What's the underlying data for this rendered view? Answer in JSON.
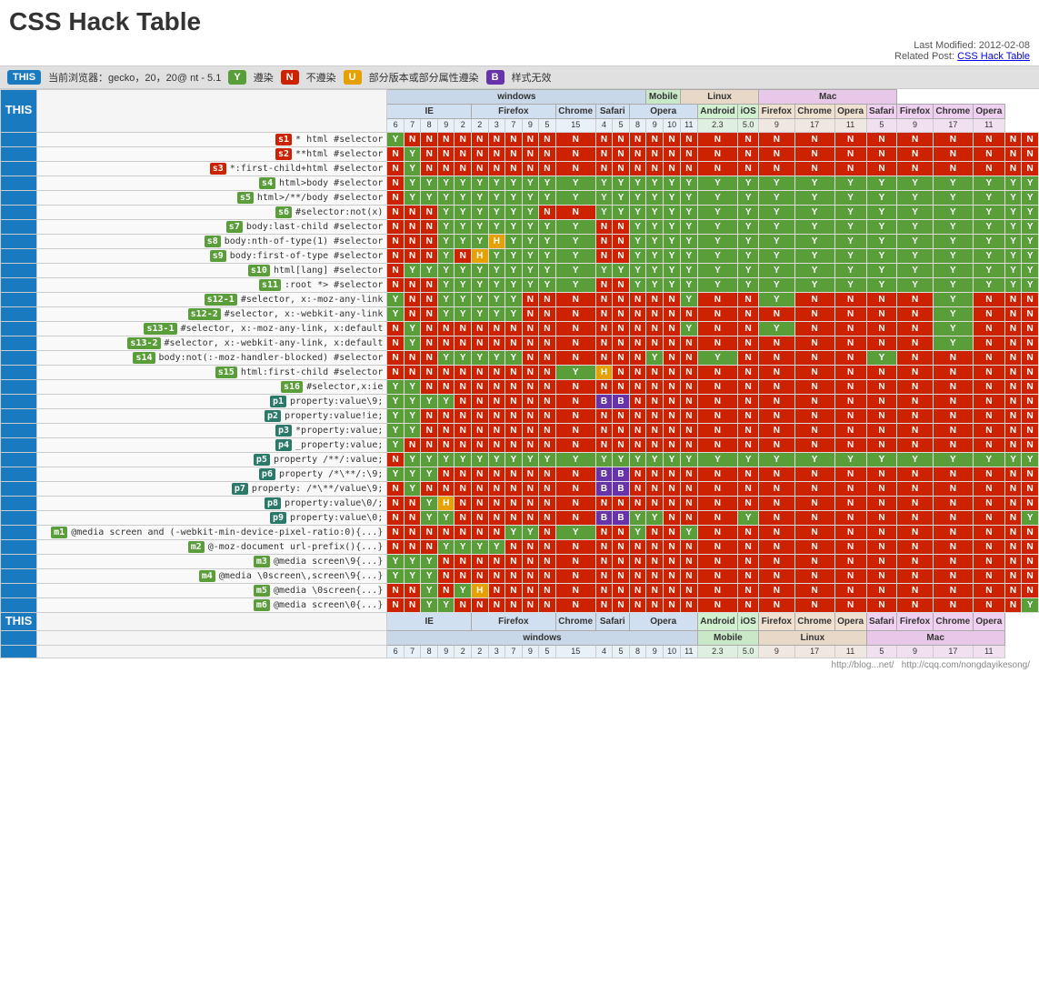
{
  "title": "CSS Hack Table",
  "meta": {
    "last_modified": "Last Modified: 2012-02-08",
    "related_label": "Related Post:",
    "related_link": "CSS Hack Table"
  },
  "legend": {
    "browser_label": "当前浏览器：gecko，20，20@ nt - 5.1",
    "y_label": "遵染",
    "n_label": "不遵染",
    "u_label": "部分版本或部分属性遵染",
    "b_label": "样式无效"
  },
  "this_label": "THIS",
  "browsers": {
    "windows": {
      "label": "windows",
      "ie": {
        "label": "IE",
        "versions": [
          "6",
          "7",
          "8",
          "9",
          "2"
        ]
      },
      "firefox": {
        "label": "Firefox",
        "versions": [
          "2",
          "3",
          "7",
          "9",
          "5"
        ]
      },
      "chrome": {
        "label": "Chrome",
        "versions": [
          "15"
        ]
      },
      "safari": {
        "label": "Safari",
        "versions": [
          "4",
          "5"
        ]
      },
      "opera": {
        "label": "Opera",
        "versions": [
          "8",
          "9",
          "10",
          "11"
        ]
      }
    },
    "mobile": {
      "label": "Mobile",
      "android": {
        "label": "Android",
        "versions": [
          "2.3"
        ]
      },
      "ios": {
        "label": "iOS",
        "versions": [
          "5.0"
        ]
      }
    },
    "linux": {
      "label": "Linux",
      "firefox": {
        "label": "Firefox",
        "versions": [
          "9"
        ]
      },
      "chrome": {
        "label": "Chrome",
        "versions": [
          "17"
        ]
      },
      "opera": {
        "label": "Opera",
        "versions": [
          "11"
        ]
      }
    },
    "mac": {
      "label": "Mac",
      "safari": {
        "label": "Safari",
        "versions": [
          "5"
        ]
      },
      "firefox": {
        "label": "Firefox",
        "versions": [
          "9"
        ]
      },
      "chrome": {
        "label": "Chrome",
        "versions": [
          "17"
        ]
      },
      "opera": {
        "label": "Opera",
        "versions": [
          "11"
        ]
      }
    }
  },
  "rows": [
    {
      "id": "s1",
      "id_class": "id-red",
      "label": "* html #selector",
      "cells": [
        "Y",
        "N",
        "N",
        "N",
        "N",
        "N",
        "N",
        "N",
        "N",
        "N",
        "N",
        "N",
        "N",
        "N",
        "N",
        "N",
        "N",
        "N",
        "N",
        "N",
        "N",
        "N",
        "N",
        "N",
        "N",
        "N",
        "N",
        "N"
      ]
    },
    {
      "id": "s2",
      "id_class": "id-red",
      "label": "**html #selector",
      "cells": [
        "N",
        "Y",
        "N",
        "N",
        "N",
        "N",
        "N",
        "N",
        "N",
        "N",
        "N",
        "N",
        "N",
        "N",
        "N",
        "N",
        "N",
        "N",
        "N",
        "N",
        "N",
        "N",
        "N",
        "N",
        "N",
        "N",
        "N",
        "N"
      ]
    },
    {
      "id": "s3",
      "id_class": "id-red",
      "label": "*:first-child+html #selector",
      "cells": [
        "N",
        "Y",
        "N",
        "N",
        "N",
        "N",
        "N",
        "N",
        "N",
        "N",
        "N",
        "N",
        "N",
        "N",
        "N",
        "N",
        "N",
        "N",
        "N",
        "N",
        "N",
        "N",
        "N",
        "N",
        "N",
        "N",
        "N",
        "N"
      ]
    },
    {
      "id": "s4",
      "id_class": "id-green",
      "label": "html>body #selector",
      "cells": [
        "N",
        "Y",
        "Y",
        "Y",
        "Y",
        "Y",
        "Y",
        "Y",
        "Y",
        "Y",
        "Y",
        "Y",
        "Y",
        "Y",
        "Y",
        "Y",
        "Y",
        "Y",
        "Y",
        "Y",
        "Y",
        "Y",
        "Y",
        "Y",
        "Y",
        "Y",
        "Y",
        "Y"
      ]
    },
    {
      "id": "s5",
      "id_class": "id-green",
      "label": "html>/**/body #selector",
      "cells": [
        "N",
        "Y",
        "Y",
        "Y",
        "Y",
        "Y",
        "Y",
        "Y",
        "Y",
        "Y",
        "Y",
        "Y",
        "Y",
        "Y",
        "Y",
        "Y",
        "Y",
        "Y",
        "Y",
        "Y",
        "Y",
        "Y",
        "Y",
        "Y",
        "Y",
        "Y",
        "Y",
        "Y"
      ]
    },
    {
      "id": "s6",
      "id_class": "id-green",
      "label": "#selector:not(x)",
      "cells": [
        "N",
        "N",
        "N",
        "Y",
        "Y",
        "Y",
        "Y",
        "Y",
        "Y",
        "N",
        "N",
        "Y",
        "Y",
        "Y",
        "Y",
        "Y",
        "Y",
        "Y",
        "Y",
        "Y",
        "Y",
        "Y",
        "Y",
        "Y",
        "Y",
        "Y",
        "Y",
        "Y"
      ]
    },
    {
      "id": "s7",
      "id_class": "id-green",
      "label": "body:last-child #selector",
      "cells": [
        "N",
        "N",
        "N",
        "Y",
        "Y",
        "Y",
        "Y",
        "Y",
        "Y",
        "Y",
        "Y",
        "N",
        "N",
        "Y",
        "Y",
        "Y",
        "Y",
        "Y",
        "Y",
        "Y",
        "Y",
        "Y",
        "Y",
        "Y",
        "Y",
        "Y",
        "Y",
        "Y"
      ]
    },
    {
      "id": "s8",
      "id_class": "id-green",
      "label": "body:nth-of-type(1) #selector",
      "cells": [
        "N",
        "N",
        "N",
        "Y",
        "Y",
        "Y",
        "H",
        "Y",
        "Y",
        "Y",
        "Y",
        "N",
        "N",
        "Y",
        "Y",
        "Y",
        "Y",
        "Y",
        "Y",
        "Y",
        "Y",
        "Y",
        "Y",
        "Y",
        "Y",
        "Y",
        "Y",
        "Y"
      ]
    },
    {
      "id": "s9",
      "id_class": "id-green",
      "label": "body:first-of-type #selector",
      "cells": [
        "N",
        "N",
        "N",
        "Y",
        "N",
        "H",
        "Y",
        "Y",
        "Y",
        "Y",
        "Y",
        "N",
        "N",
        "Y",
        "Y",
        "Y",
        "Y",
        "Y",
        "Y",
        "Y",
        "Y",
        "Y",
        "Y",
        "Y",
        "Y",
        "Y",
        "Y",
        "Y"
      ]
    },
    {
      "id": "s10",
      "id_class": "id-green",
      "label": "html[lang] #selector",
      "cells": [
        "N",
        "Y",
        "Y",
        "Y",
        "Y",
        "Y",
        "Y",
        "Y",
        "Y",
        "Y",
        "Y",
        "Y",
        "Y",
        "Y",
        "Y",
        "Y",
        "Y",
        "Y",
        "Y",
        "Y",
        "Y",
        "Y",
        "Y",
        "Y",
        "Y",
        "Y",
        "Y",
        "Y"
      ]
    },
    {
      "id": "s11",
      "id_class": "id-green",
      "label": ":root *> #selector",
      "cells": [
        "N",
        "N",
        "N",
        "Y",
        "Y",
        "Y",
        "Y",
        "Y",
        "Y",
        "Y",
        "Y",
        "N",
        "N",
        "Y",
        "Y",
        "Y",
        "Y",
        "Y",
        "Y",
        "Y",
        "Y",
        "Y",
        "Y",
        "Y",
        "Y",
        "Y",
        "Y",
        "Y"
      ]
    },
    {
      "id": "s12-1",
      "id_class": "id-green",
      "label": "#selector, x:-moz-any-link",
      "cells": [
        "Y",
        "N",
        "N",
        "Y",
        "Y",
        "Y",
        "Y",
        "Y",
        "N",
        "N",
        "N",
        "N",
        "N",
        "N",
        "N",
        "N",
        "Y",
        "N",
        "N",
        "Y",
        "N",
        "N",
        "N",
        "N",
        "Y",
        "N",
        "N",
        "N"
      ]
    },
    {
      "id": "s12-2",
      "id_class": "id-green",
      "label": "#selector, x:-webkit-any-link",
      "cells": [
        "Y",
        "N",
        "N",
        "Y",
        "Y",
        "Y",
        "Y",
        "Y",
        "N",
        "N",
        "N",
        "N",
        "N",
        "N",
        "N",
        "N",
        "N",
        "N",
        "N",
        "N",
        "N",
        "N",
        "N",
        "N",
        "Y",
        "N",
        "N",
        "N"
      ]
    },
    {
      "id": "s13-1",
      "id_class": "id-green",
      "label": "#selector, x:-moz-any-link, x:default",
      "cells": [
        "N",
        "Y",
        "N",
        "N",
        "N",
        "N",
        "N",
        "N",
        "N",
        "N",
        "N",
        "N",
        "N",
        "N",
        "N",
        "N",
        "Y",
        "N",
        "N",
        "Y",
        "N",
        "N",
        "N",
        "N",
        "Y",
        "N",
        "N",
        "N"
      ]
    },
    {
      "id": "s13-2",
      "id_class": "id-green",
      "label": "#selector, x:-webkit-any-link, x:default",
      "cells": [
        "N",
        "Y",
        "N",
        "N",
        "N",
        "N",
        "N",
        "N",
        "N",
        "N",
        "N",
        "N",
        "N",
        "N",
        "N",
        "N",
        "N",
        "N",
        "N",
        "N",
        "N",
        "N",
        "N",
        "N",
        "Y",
        "N",
        "N",
        "N"
      ]
    },
    {
      "id": "s14",
      "id_class": "id-green",
      "label": "body:not(:-moz-handler-blocked) #selector",
      "cells": [
        "N",
        "N",
        "N",
        "Y",
        "Y",
        "Y",
        "Y",
        "Y",
        "N",
        "N",
        "N",
        "N",
        "N",
        "N",
        "Y",
        "N",
        "N",
        "Y",
        "N",
        "N",
        "N",
        "N",
        "Y",
        "N",
        "N",
        "N",
        "N",
        "N"
      ]
    },
    {
      "id": "s15",
      "id_class": "id-green",
      "label": "html:first-child #selector",
      "cells": [
        "N",
        "N",
        "N",
        "N",
        "N",
        "N",
        "N",
        "N",
        "N",
        "N",
        "Y",
        "H",
        "N",
        "N",
        "N",
        "N",
        "N",
        "N",
        "N",
        "N",
        "N",
        "N",
        "N",
        "N",
        "N",
        "N",
        "N",
        "N"
      ]
    },
    {
      "id": "s16",
      "id_class": "id-green",
      "label": "#selector,x:ie",
      "cells": [
        "Y",
        "Y",
        "N",
        "N",
        "N",
        "N",
        "N",
        "N",
        "N",
        "N",
        "N",
        "N",
        "N",
        "N",
        "N",
        "N",
        "N",
        "N",
        "N",
        "N",
        "N",
        "N",
        "N",
        "N",
        "N",
        "N",
        "N",
        "N"
      ]
    },
    {
      "id": "p1",
      "id_class": "id-teal",
      "label": "property:value\\9;",
      "cells": [
        "Y",
        "Y",
        "Y",
        "Y",
        "N",
        "N",
        "N",
        "N",
        "N",
        "N",
        "N",
        "B",
        "B",
        "N",
        "N",
        "N",
        "N",
        "N",
        "N",
        "N",
        "N",
        "N",
        "N",
        "N",
        "N",
        "N",
        "N",
        "N"
      ]
    },
    {
      "id": "p2",
      "id_class": "id-teal",
      "label": "property:value!ie;",
      "cells": [
        "Y",
        "Y",
        "N",
        "N",
        "N",
        "N",
        "N",
        "N",
        "N",
        "N",
        "N",
        "N",
        "N",
        "N",
        "N",
        "N",
        "N",
        "N",
        "N",
        "N",
        "N",
        "N",
        "N",
        "N",
        "N",
        "N",
        "N",
        "N"
      ]
    },
    {
      "id": "p3",
      "id_class": "id-teal",
      "label": "*property:value;",
      "cells": [
        "Y",
        "Y",
        "N",
        "N",
        "N",
        "N",
        "N",
        "N",
        "N",
        "N",
        "N",
        "N",
        "N",
        "N",
        "N",
        "N",
        "N",
        "N",
        "N",
        "N",
        "N",
        "N",
        "N",
        "N",
        "N",
        "N",
        "N",
        "N"
      ]
    },
    {
      "id": "p4",
      "id_class": "id-teal",
      "label": "_property:value;",
      "cells": [
        "Y",
        "N",
        "N",
        "N",
        "N",
        "N",
        "N",
        "N",
        "N",
        "N",
        "N",
        "N",
        "N",
        "N",
        "N",
        "N",
        "N",
        "N",
        "N",
        "N",
        "N",
        "N",
        "N",
        "N",
        "N",
        "N",
        "N",
        "N"
      ]
    },
    {
      "id": "p5",
      "id_class": "id-teal",
      "label": "property /**/:value;",
      "cells": [
        "N",
        "Y",
        "Y",
        "Y",
        "Y",
        "Y",
        "Y",
        "Y",
        "Y",
        "Y",
        "Y",
        "Y",
        "Y",
        "Y",
        "Y",
        "Y",
        "Y",
        "Y",
        "Y",
        "Y",
        "Y",
        "Y",
        "Y",
        "Y",
        "Y",
        "Y",
        "Y",
        "Y"
      ]
    },
    {
      "id": "p6",
      "id_class": "id-teal",
      "label": "property /*\\**/:\\9;",
      "cells": [
        "Y",
        "Y",
        "Y",
        "N",
        "N",
        "N",
        "N",
        "N",
        "N",
        "N",
        "N",
        "B",
        "B",
        "N",
        "N",
        "N",
        "N",
        "N",
        "N",
        "N",
        "N",
        "N",
        "N",
        "N",
        "N",
        "N",
        "N",
        "N"
      ]
    },
    {
      "id": "p7",
      "id_class": "id-teal",
      "label": "property: /*\\**/value\\9;",
      "cells": [
        "N",
        "Y",
        "N",
        "N",
        "N",
        "N",
        "N",
        "N",
        "N",
        "N",
        "N",
        "B",
        "B",
        "N",
        "N",
        "N",
        "N",
        "N",
        "N",
        "N",
        "N",
        "N",
        "N",
        "N",
        "N",
        "N",
        "N",
        "N"
      ]
    },
    {
      "id": "p8",
      "id_class": "id-teal",
      "label": "property:value\\0/;",
      "cells": [
        "N",
        "N",
        "Y",
        "H",
        "N",
        "N",
        "N",
        "N",
        "N",
        "N",
        "N",
        "N",
        "N",
        "N",
        "N",
        "N",
        "N",
        "N",
        "N",
        "N",
        "N",
        "N",
        "N",
        "N",
        "N",
        "N",
        "N",
        "N"
      ]
    },
    {
      "id": "p9",
      "id_class": "id-teal",
      "label": "property:value\\0;",
      "cells": [
        "N",
        "N",
        "Y",
        "Y",
        "N",
        "N",
        "N",
        "N",
        "N",
        "N",
        "N",
        "B",
        "B",
        "Y",
        "Y",
        "N",
        "N",
        "N",
        "Y",
        "N",
        "N",
        "N",
        "N",
        "N",
        "N",
        "N",
        "N",
        "Y"
      ]
    },
    {
      "id": "m1",
      "id_class": "id-green",
      "label": "@media screen and (-webkit-min-device-pixel-ratio:0){...}",
      "cells": [
        "N",
        "N",
        "N",
        "N",
        "N",
        "N",
        "N",
        "Y",
        "Y",
        "N",
        "Y",
        "N",
        "N",
        "Y",
        "N",
        "N",
        "Y",
        "N",
        "N",
        "N",
        "N",
        "N",
        "N",
        "N",
        "N",
        "N",
        "N",
        "N"
      ]
    },
    {
      "id": "m2",
      "id_class": "id-green",
      "label": "@-moz-document url-prefix(){...}",
      "cells": [
        "N",
        "N",
        "N",
        "Y",
        "Y",
        "Y",
        "Y",
        "N",
        "N",
        "N",
        "N",
        "N",
        "N",
        "N",
        "N",
        "N",
        "N",
        "N",
        "N",
        "N",
        "N",
        "N",
        "N",
        "N",
        "N",
        "N",
        "N",
        "N"
      ]
    },
    {
      "id": "m3",
      "id_class": "id-green",
      "label": "@media screen\\9{...}",
      "cells": [
        "Y",
        "Y",
        "Y",
        "N",
        "N",
        "N",
        "N",
        "N",
        "N",
        "N",
        "N",
        "N",
        "N",
        "N",
        "N",
        "N",
        "N",
        "N",
        "N",
        "N",
        "N",
        "N",
        "N",
        "N",
        "N",
        "N",
        "N",
        "N"
      ]
    },
    {
      "id": "m4",
      "id_class": "id-green",
      "label": "@media \\0screen\\,screen\\9{...}",
      "cells": [
        "Y",
        "Y",
        "Y",
        "N",
        "N",
        "N",
        "N",
        "N",
        "N",
        "N",
        "N",
        "N",
        "N",
        "N",
        "N",
        "N",
        "N",
        "N",
        "N",
        "N",
        "N",
        "N",
        "N",
        "N",
        "N",
        "N",
        "N",
        "N"
      ]
    },
    {
      "id": "m5",
      "id_class": "id-green",
      "label": "@media \\0screen{...}",
      "cells": [
        "N",
        "N",
        "Y",
        "N",
        "Y",
        "H",
        "N",
        "N",
        "N",
        "N",
        "N",
        "N",
        "N",
        "N",
        "N",
        "N",
        "N",
        "N",
        "N",
        "N",
        "N",
        "N",
        "N",
        "N",
        "N",
        "N",
        "N",
        "N"
      ]
    },
    {
      "id": "m6",
      "id_class": "id-green",
      "label": "@media screen\\0{...}",
      "cells": [
        "N",
        "N",
        "Y",
        "Y",
        "N",
        "N",
        "N",
        "N",
        "N",
        "N",
        "N",
        "N",
        "N",
        "N",
        "N",
        "N",
        "N",
        "N",
        "N",
        "N",
        "N",
        "N",
        "N",
        "N",
        "N",
        "N",
        "N",
        "Y"
      ]
    }
  ],
  "col_headers": {
    "ie_versions": [
      "6",
      "7",
      "8",
      "9",
      "2"
    ],
    "firefox_versions": [
      "2",
      "3",
      "7",
      "9",
      "5"
    ],
    "chrome_versions": [
      "15"
    ],
    "safari_versions": [
      "4",
      "5"
    ],
    "opera_versions": [
      "8",
      "9",
      "10",
      "11"
    ],
    "android_versions": [
      "2.3"
    ],
    "ios_versions": [
      "5.0"
    ],
    "linux_firefox_versions": [
      "9"
    ],
    "linux_chrome_versions": [
      "17"
    ],
    "linux_opera_versions": [
      "11"
    ],
    "mac_safari_versions": [
      "5"
    ],
    "mac_firefox_versions": [
      "9"
    ],
    "mac_chrome_versions": [
      "17"
    ],
    "mac_opera_versions": [
      "11"
    ]
  }
}
